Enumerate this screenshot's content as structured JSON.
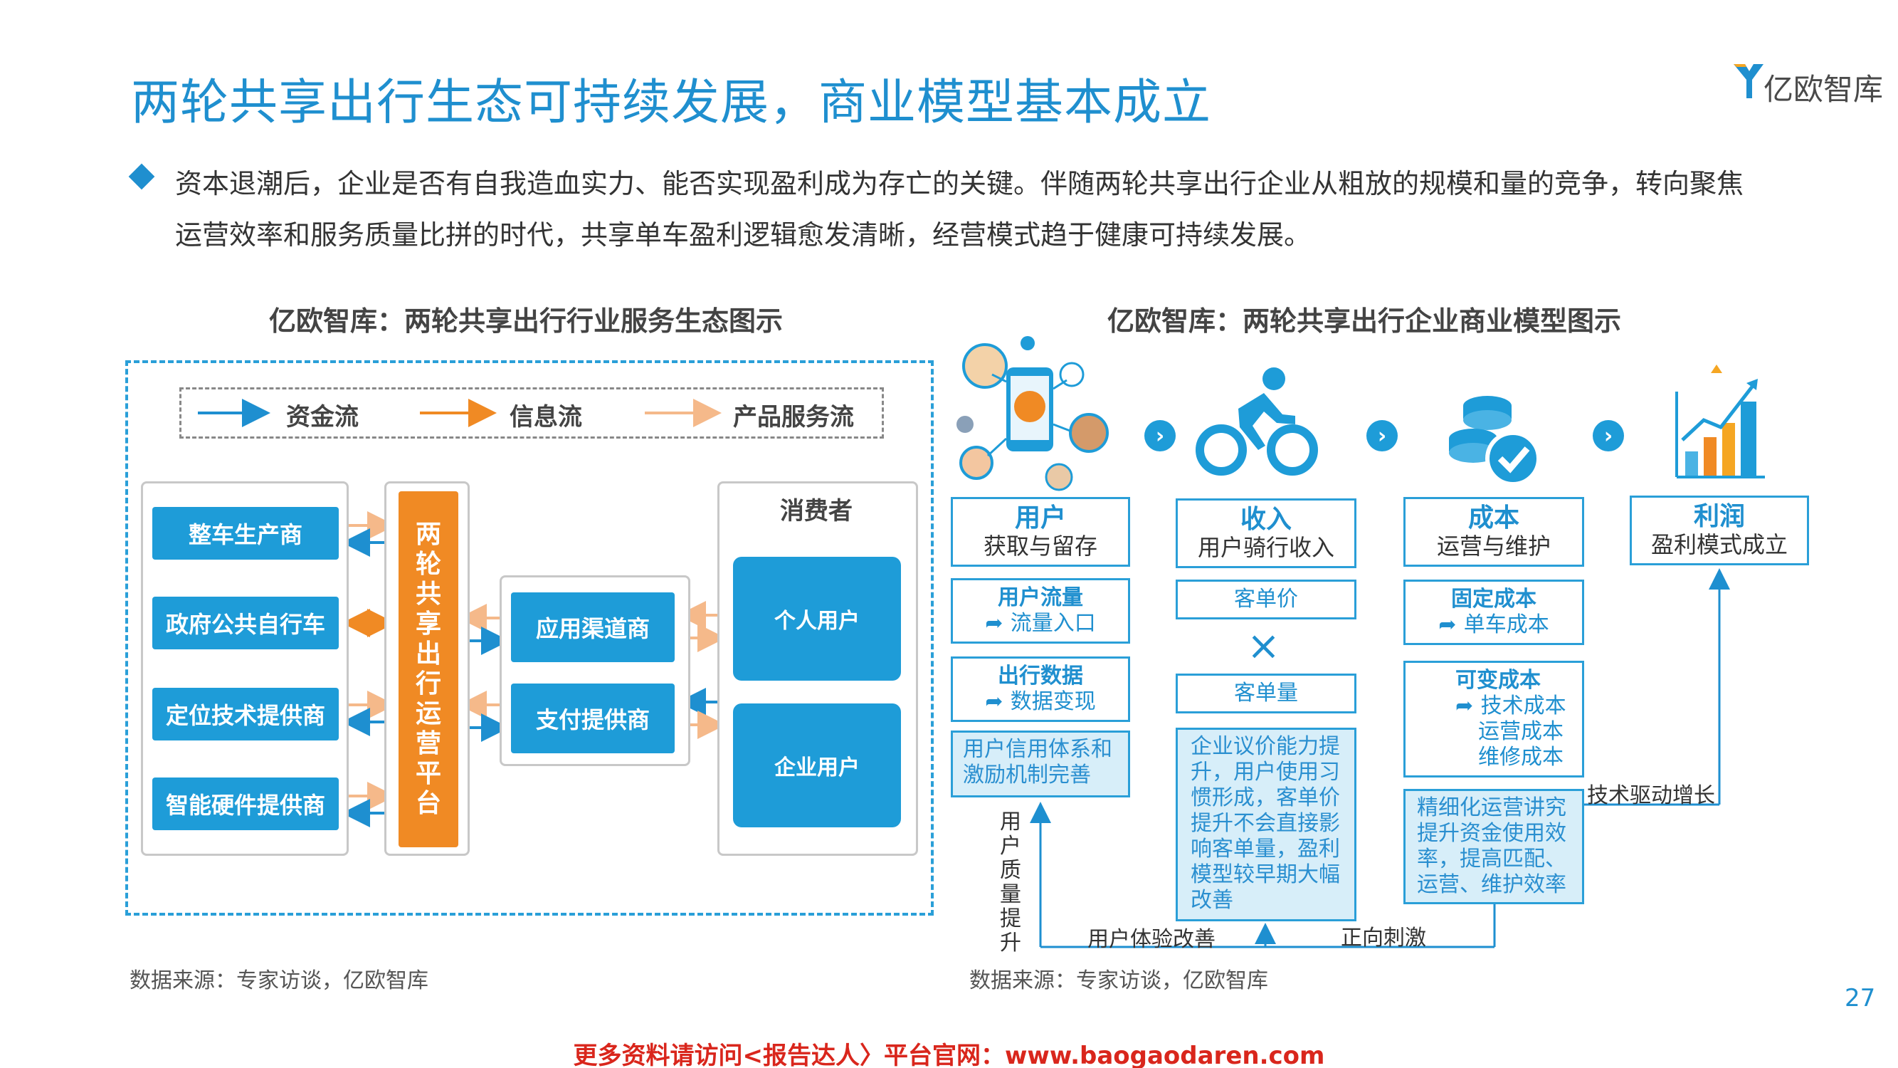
{
  "header": {
    "title": "两轮共享出行生态可持续发展，商业模型基本成立",
    "logo_text": "亿欧智库"
  },
  "intro": {
    "text": "资本退潮后，企业是否有自我造血实力、能否实现盈利成为存亡的关键。伴随两轮共享出行企业从粗放的规模和量的竞争，转向聚焦运营效率和服务质量比拼的时代，共享单车盈利逻辑愈发清晰，经营模式趋于健康可持续发展。"
  },
  "left_diagram": {
    "subtitle": "亿欧智库：两轮共享出行行业服务生态图示",
    "legend": {
      "capital_flow": "资金流",
      "info_flow": "信息流",
      "product_flow": "产品服务流"
    },
    "suppliers": [
      "整车生产商",
      "政府公共自行车",
      "定位技术提供商",
      "智能硬件提供商"
    ],
    "platform_chars": [
      "两",
      "轮",
      "共",
      "享",
      "出",
      "行",
      "运",
      "营",
      "平",
      "台"
    ],
    "channels": [
      "应用渠道商",
      "支付提供商"
    ],
    "consumer_label": "消费者",
    "consumers": [
      "个人用户",
      "企业用户"
    ],
    "source": "数据来源：专家访谈，亿欧智库"
  },
  "right_diagram": {
    "subtitle": "亿欧智库：两轮共享出行企业商业模型图示",
    "stages": [
      {
        "title": "用户",
        "sub": "获取与留存"
      },
      {
        "title": "收入",
        "sub": "用户骑行收入"
      },
      {
        "title": "成本",
        "sub": "运营与维护"
      },
      {
        "title": "利润",
        "sub": "盈利模式成立"
      }
    ],
    "user_col": {
      "flow_title": "用户流量",
      "flow_sub": "流量入口",
      "data_title": "出行数据",
      "data_sub": "数据变现",
      "note": "用户信用体系和激励机制完善"
    },
    "income_col": {
      "price": "客单价",
      "multiply": "×",
      "volume": "客单量",
      "note": "企业议价能力提升，用户使用习惯形成，客单价提升不会直接影响客单量，盈利模型较早期大幅改善"
    },
    "cost_col": {
      "fixed_title": "固定成本",
      "fixed_sub": "单车成本",
      "variable_title": "可变成本",
      "variable_items": [
        "技术成本",
        "运营成本",
        "维修成本"
      ],
      "note": "精细化运营讲究提升资金使用效率，提高匹配、运营、维护效率"
    },
    "flow_labels": {
      "user_quality": "用户质量提升",
      "user_experience": "用户体验改善",
      "positive": "正向刺激",
      "tech_growth": "技术驱动增长"
    },
    "source": "数据来源：专家访谈，亿欧智库"
  },
  "page_number": "27",
  "footer": "更多资料请访问<报告达人〉平台官网：www.baogaodaren.com",
  "colors": {
    "brand_blue": "#1f8fcf",
    "box_blue": "#1e9cd8",
    "platform_orange": "#f08a24",
    "footer_red": "#d9261c"
  }
}
